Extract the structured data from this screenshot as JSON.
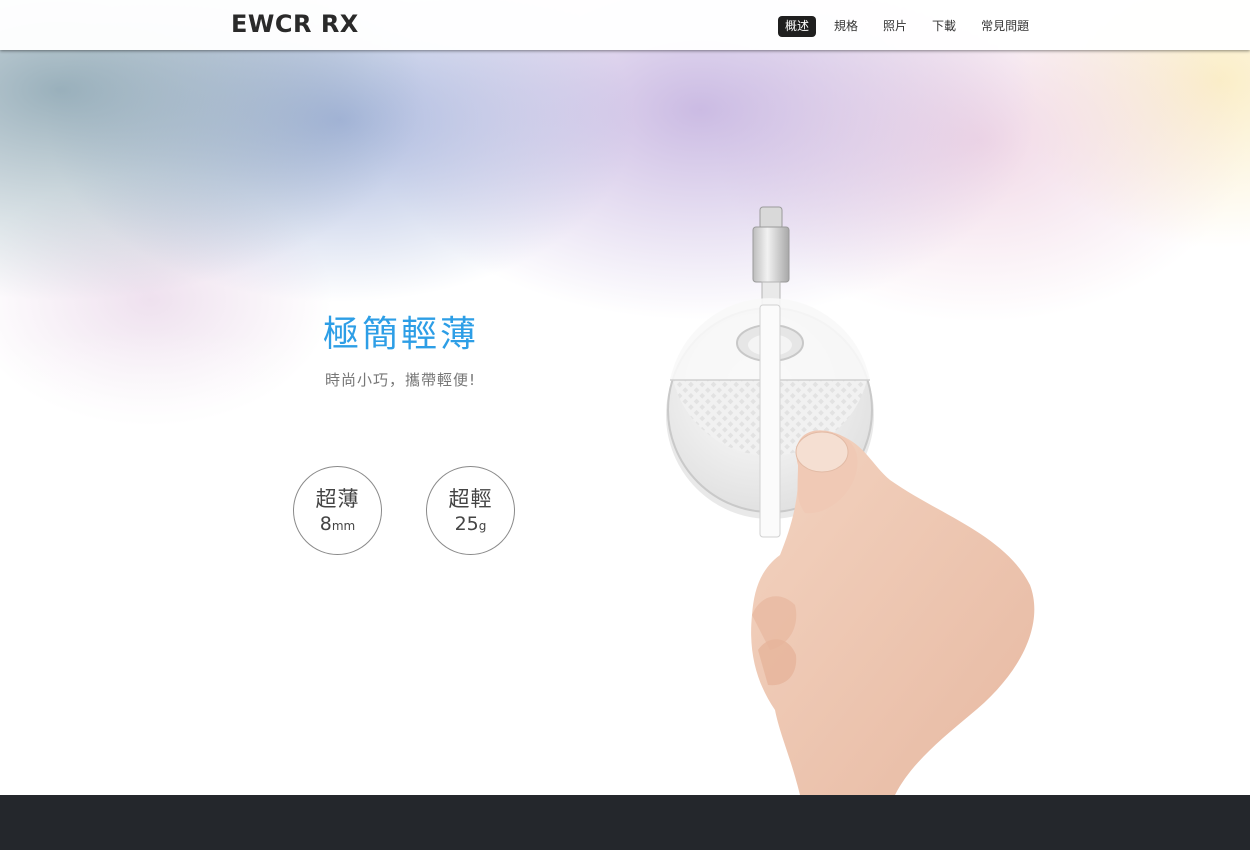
{
  "navbar": {
    "brand": "EWCR RX",
    "items": [
      {
        "label": "概述",
        "active": true
      },
      {
        "label": "規格",
        "active": false
      },
      {
        "label": "照片",
        "active": false
      },
      {
        "label": "下載",
        "active": false
      },
      {
        "label": "常見問題",
        "active": false
      }
    ]
  },
  "hero": {
    "headline": "極簡輕薄",
    "subline": "時尚小巧，攜帶輕便!",
    "badges": [
      {
        "title": "超薄",
        "value": "8",
        "unit": "mm"
      },
      {
        "title": "超輕",
        "value": "25",
        "unit": "g"
      }
    ]
  },
  "colors": {
    "accent": "#2d9ee6",
    "footer": "#24272c",
    "nav_active": "#1f1f1f"
  },
  "icons": {
    "product": "usb-c-card-reader-in-hand"
  }
}
